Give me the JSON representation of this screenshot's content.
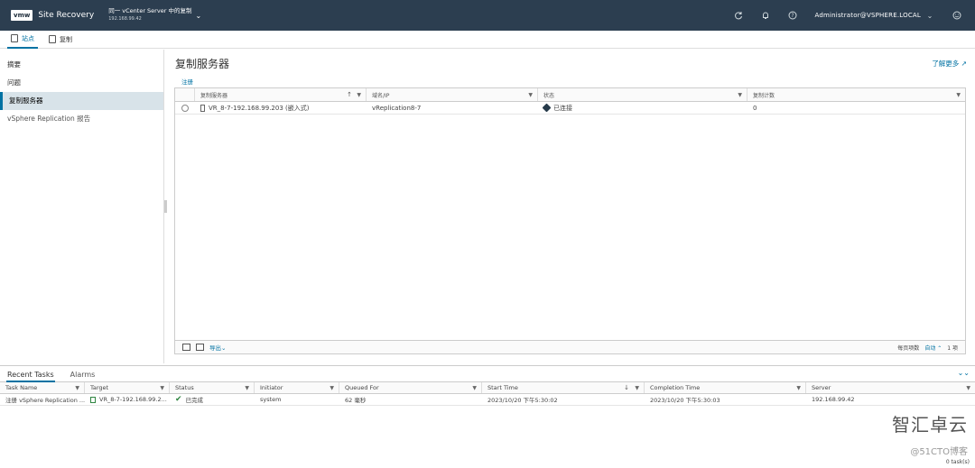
{
  "header": {
    "logo": "vmw",
    "app_title": "Site Recovery",
    "vc_name": "同一 vCenter Server 中的复制",
    "vc_ip": "192.168.99.42",
    "user": "Administrator@VSPHERE.LOCAL"
  },
  "subnav": {
    "tabs": [
      {
        "label": "站点"
      },
      {
        "label": "复制"
      }
    ]
  },
  "leftnav": {
    "items": [
      {
        "label": "摘要"
      },
      {
        "label": "问题"
      },
      {
        "label": "复制服务器"
      },
      {
        "label": "vSphere Replication 报告"
      }
    ]
  },
  "main": {
    "title": "复制服务器",
    "learn_more": "了解更多",
    "register": "注册",
    "grid": {
      "columns": [
        "复制服务器",
        "域名/IP",
        "状态",
        "复制计数"
      ],
      "rows": [
        {
          "server": "VR_8-7-192.168.99.203 (嵌入式)",
          "ip": "vReplication8-7",
          "status": "已连接",
          "count": "0"
        }
      ],
      "export": "导出",
      "page_size_label": "每页项数",
      "page_size_value": "自动",
      "item_count": "1 项"
    }
  },
  "bottom": {
    "tabs": [
      "Recent Tasks",
      "Alarms"
    ],
    "columns": [
      "Task Name",
      "Target",
      "Status",
      "Initiator",
      "Queued For",
      "Start Time",
      "Completion Time",
      "Server"
    ],
    "rows": [
      {
        "task": "注册 vSphere Replication ...",
        "target": "VR_8-7-192.168.99.2...",
        "status": "已完成",
        "initiator": "system",
        "queued": "62 毫秒",
        "start": "2023/10/20 下午5:30:02",
        "completion": "2023/10/20 下午5:30:03",
        "server": "192.168.99.42"
      }
    ],
    "task_count": "0 task(s)"
  },
  "watermark": {
    "brand": "智汇卓云",
    "site": "@51CTO博客"
  },
  "colors": {
    "header_bg": "#2c3e50",
    "accent": "#0072a3",
    "success": "#2e8540"
  }
}
